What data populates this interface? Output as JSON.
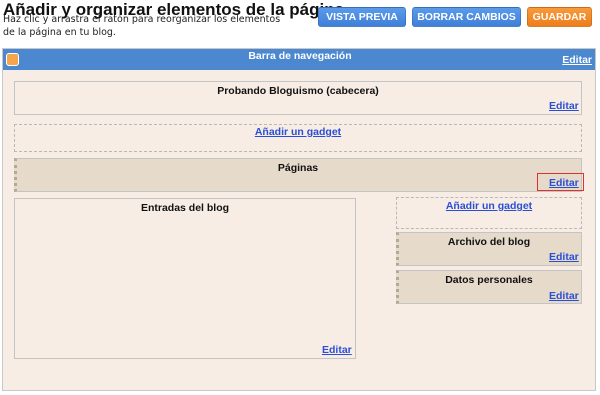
{
  "header": {
    "title": "Añadir y organizar elementos de la página",
    "description": "Haz clic y arrastra el ratón para reorganizar los elementos de la página en tu blog."
  },
  "toolbar": {
    "preview_label": "VISTA PREVIA",
    "clear_label": "BORRAR CAMBIOS",
    "save_label": "GUARDAR"
  },
  "navbar": {
    "title": "Barra de navegación",
    "edit_label": "Editar"
  },
  "header_gadget": {
    "title": "Probando Bloguismo (cabecera)",
    "edit_label": "Editar"
  },
  "add_gadget_top": {
    "label": "Añadir un gadget"
  },
  "pages_gadget": {
    "title": "Páginas",
    "edit_label": "Editar"
  },
  "blog_posts": {
    "title": "Entradas del blog",
    "edit_label": "Editar"
  },
  "sidebar": {
    "add_gadget_label": "Añadir un gadget",
    "gadgets": [
      {
        "title": "Archivo del blog",
        "edit_label": "Editar"
      },
      {
        "title": "Datos personales",
        "edit_label": "Editar"
      }
    ]
  },
  "colors": {
    "primary_button": "#4a8be3",
    "save_button": "#f08a2a",
    "navbar": "#4b88cf",
    "link": "#2a4ed6",
    "highlight": "#e2302b"
  },
  "icons": {
    "navbar_icon": "blogger-icon"
  }
}
